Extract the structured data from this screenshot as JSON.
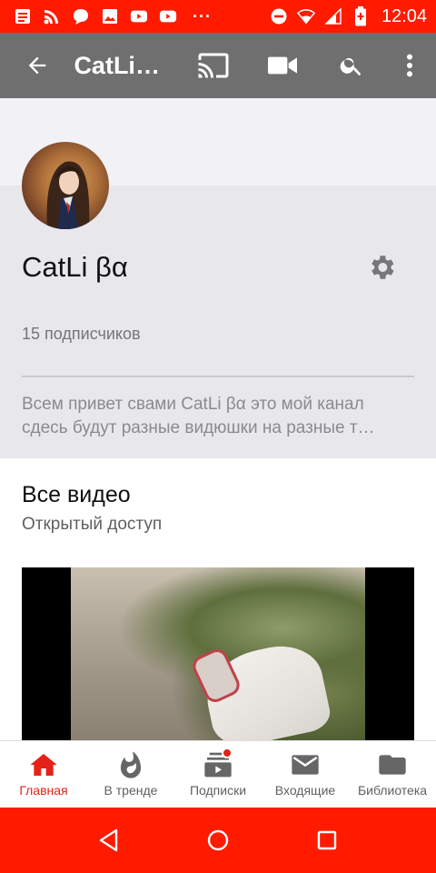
{
  "status_bar": {
    "time": "12:04",
    "left_icons": [
      "notes-icon",
      "rss-icon",
      "chat-icon",
      "image-icon",
      "youtube-icon",
      "youtube-icon"
    ],
    "right_icons": [
      "do-not-disturb-icon",
      "wifi-icon",
      "signal-icon",
      "battery-icon"
    ],
    "dots": "···",
    "color": "#ff1a00"
  },
  "toolbar": {
    "title": "CatLi…",
    "actions": [
      "cast-icon",
      "video-camera-icon",
      "search-icon",
      "more-vert-icon"
    ],
    "color": "#6f6f6f"
  },
  "channel": {
    "name": "CatLi βα",
    "subscribers": "15 подписчиков",
    "description_line1": "Всем привет свами CatLi βα это мой канал",
    "description_line2": "сдесь будут разные видюшки на разные т…"
  },
  "section": {
    "title": "Все видео",
    "subtitle": "Открытый доступ"
  },
  "bottom_nav": {
    "items": [
      {
        "label": "Главная",
        "icon": "home-icon",
        "active": true
      },
      {
        "label": "В тренде",
        "icon": "trending-fire-icon",
        "active": false
      },
      {
        "label": "Подписки",
        "icon": "subscriptions-icon",
        "active": false
      },
      {
        "label": "Входящие",
        "icon": "inbox-mail-icon",
        "active": false
      },
      {
        "label": "Библиотека",
        "icon": "library-folder-icon",
        "active": false
      }
    ],
    "accent": "#e62117"
  },
  "system_nav": [
    "back-icon",
    "home-circle-icon",
    "recents-icon"
  ]
}
